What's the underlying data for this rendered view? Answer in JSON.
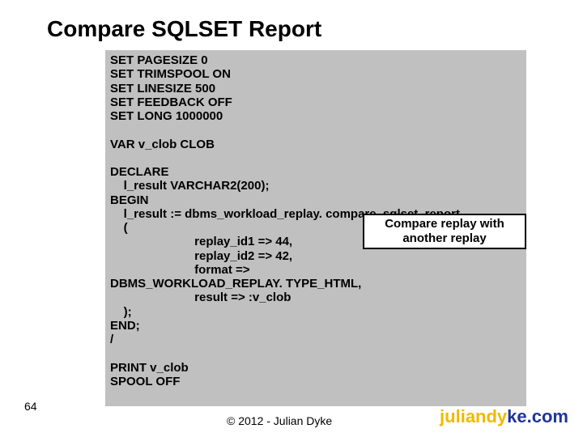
{
  "title": "Compare SQLSET Report",
  "code": "SET PAGESIZE 0\nSET TRIMSPOOL ON\nSET LINESIZE 500\nSET FEEDBACK OFF\nSET LONG 1000000\n\nVAR v_clob CLOB\n\nDECLARE\n    l_result VARCHAR2(200);\nBEGIN\n    l_result := dbms_workload_replay. compare_sqlset_report\n    (\n                         replay_id1 => 44,\n                         replay_id2 => 42,\n                         format =>\nDBMS_WORKLOAD_REPLAY. TYPE_HTML,\n                         result => :v_clob\n    );\nEND;\n/\n\nPRINT v_clob\nSPOOL OFF",
  "annotation": "Compare replay with another replay",
  "page_number": "64",
  "copyright": "© 2012 - Julian Dyke",
  "brand_a": "juliandy",
  "brand_b": "ke.com"
}
